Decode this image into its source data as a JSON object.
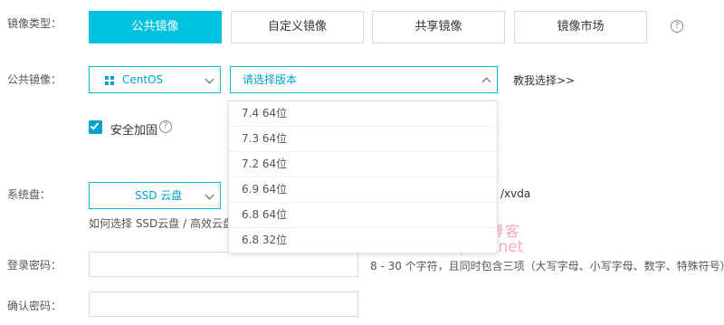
{
  "image_type": {
    "label": "镜像类型：",
    "tabs": [
      "公共镜像",
      "自定义镜像",
      "共享镜像",
      "镜像市场"
    ],
    "help": "?"
  },
  "public_image": {
    "label": "公共镜像：",
    "os_value": "CentOS",
    "version_placeholder": "请选择版本",
    "tutorial_link": "教我选择>>",
    "version_options": [
      "7.4 64位",
      "7.3 64位",
      "7.2 64位",
      "6.9 64位",
      "6.8 64位",
      "6.8 32位"
    ]
  },
  "security": {
    "label": "安全加固",
    "checked": true,
    "help": "?"
  },
  "system_disk": {
    "label": "系统盘：",
    "value": "SSD 云盘",
    "device_suffix": "/xvda",
    "help_text": "如何选择 SSD云盘 / 高效云盘 /"
  },
  "watermark": {
    "line1": "魏艾斯博客",
    "line2": "www.vpsss.net"
  },
  "password": {
    "label": "登录密码：",
    "hint": "8 - 30 个字符，且同时包含三项（大写字母、小写字母、数字、特殊符号）"
  },
  "confirm_password": {
    "label": "确认密码："
  },
  "colors": {
    "accent": "#00c1de",
    "checkbox": "#00a2ca",
    "watermark": "#f3a9c4"
  }
}
